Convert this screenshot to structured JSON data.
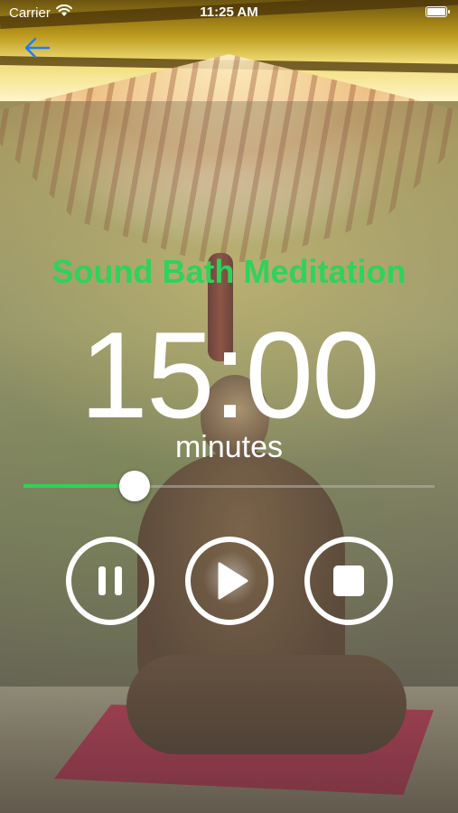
{
  "status_bar": {
    "carrier": "Carrier",
    "time": "11:25 AM"
  },
  "nav": {
    "back_icon": "back-arrow-icon",
    "accent_color": "#1f7cf2"
  },
  "main": {
    "title": "Sound Bath Meditation",
    "title_color": "#2fd25a",
    "timer": "15:00",
    "unit": "minutes",
    "slider": {
      "value_fraction": 0.27,
      "fill_color": "#2fd25a"
    },
    "controls": [
      {
        "icon": "pause-icon"
      },
      {
        "icon": "play-icon"
      },
      {
        "icon": "stop-icon"
      }
    ]
  }
}
